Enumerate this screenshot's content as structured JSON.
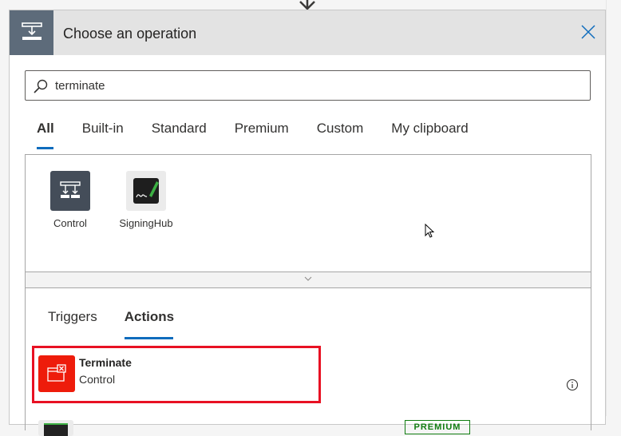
{
  "header": {
    "title": "Choose an operation",
    "icon": "control-flow-icon",
    "close_icon": "close-icon"
  },
  "search": {
    "value": "terminate",
    "icon": "search-icon"
  },
  "tabs": [
    {
      "label": "All",
      "active": true
    },
    {
      "label": "Built-in",
      "active": false
    },
    {
      "label": "Standard",
      "active": false
    },
    {
      "label": "Premium",
      "active": false
    },
    {
      "label": "Custom",
      "active": false
    },
    {
      "label": "My clipboard",
      "active": false
    }
  ],
  "connectors": [
    {
      "label": "Control",
      "icon": "control-icon",
      "color": "#444d59"
    },
    {
      "label": "SigningHub",
      "icon": "signinghub-icon",
      "color": "#ebebeb"
    }
  ],
  "expand": {
    "icon": "chevron-down-icon"
  },
  "subtabs": [
    {
      "label": "Triggers",
      "active": false
    },
    {
      "label": "Actions",
      "active": true
    }
  ],
  "actions": [
    {
      "title": "Terminate",
      "connector": "Control",
      "icon": "terminate-icon",
      "color": "#ee1c0b",
      "highlighted": true
    },
    {
      "title": "",
      "connector": "",
      "icon": "signinghub-icon",
      "badge": "PREMIUM"
    }
  ],
  "colors": {
    "accent": "#0f6cbd",
    "highlight": "#e81123",
    "premium": "#107c10"
  }
}
